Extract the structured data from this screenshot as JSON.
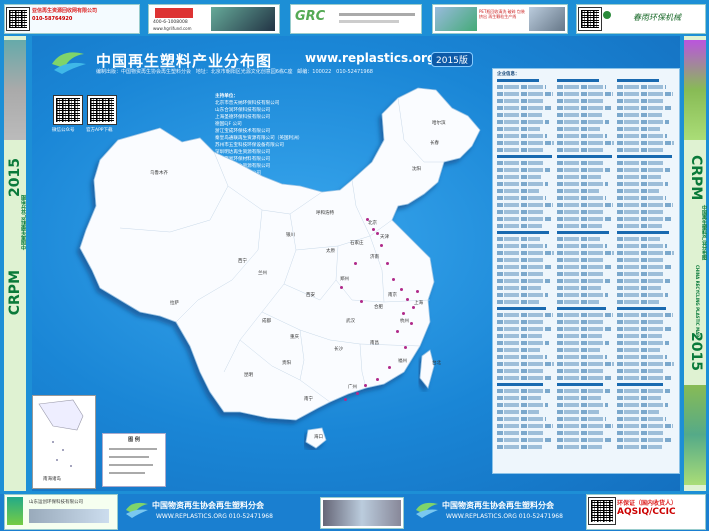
{
  "header": {
    "title": "中国再生塑料产业分布图",
    "url": "www.replastics.org",
    "edition": "2015版",
    "subline_editor": "编制出版：中国物资再生协会再生塑料分会",
    "subline_address": "地址：北京市朝阳区光源文化创意园6栋C座",
    "subline_post": "邮编：100022",
    "subline_phone": "010-52471968"
  },
  "side": {
    "brand": "CRPM",
    "cn": "中国再生塑料产业分布图",
    "en": "CHINA RECYCLING PLASTIC MAP",
    "year": "2015"
  },
  "qr": {
    "left_caption": "微信公众号",
    "right_caption": "官方APP下载"
  },
  "sponsors": {
    "heading": "主持单位：",
    "items": [
      "北京市普天纳环保科技有限公司",
      "山东合润环保科技有限公司",
      "上海圣德环保科技有限公司",
      "德国EJF 公司",
      "浙江宝成环保技术有限公司",
      "秦皇岛通联再生资源有限公司（英国利洲）",
      "苏州市五宝科技环保设备有限公司",
      "深圳明达再生资源有限公司",
      "安徽原易环保材料有限公司",
      "江苏新顺再生资源有限公司",
      "苏州华塑环保有限公司"
    ]
  },
  "map": {
    "cities": [
      {
        "name": "乌鲁木齐"
      },
      {
        "name": "拉萨"
      },
      {
        "name": "西宁"
      },
      {
        "name": "兰州"
      },
      {
        "name": "银川"
      },
      {
        "name": "呼和浩特"
      },
      {
        "name": "北京"
      },
      {
        "name": "天津"
      },
      {
        "name": "石家庄"
      },
      {
        "name": "太原"
      },
      {
        "name": "济南"
      },
      {
        "name": "郑州"
      },
      {
        "name": "西安"
      },
      {
        "name": "成都"
      },
      {
        "name": "重庆"
      },
      {
        "name": "武汉"
      },
      {
        "name": "长沙"
      },
      {
        "name": "南京"
      },
      {
        "name": "上海"
      },
      {
        "name": "杭州"
      },
      {
        "name": "合肥"
      },
      {
        "name": "南昌"
      },
      {
        "name": "福州"
      },
      {
        "name": "广州"
      },
      {
        "name": "南宁"
      },
      {
        "name": "海口"
      },
      {
        "name": "昆明"
      },
      {
        "name": "贵阳"
      },
      {
        "name": "哈尔滨"
      },
      {
        "name": "长春"
      },
      {
        "name": "沈阳"
      },
      {
        "name": "台北"
      }
    ],
    "inset_label": "南海诸岛",
    "legend_title": "图 例"
  },
  "list": {
    "heading": "企业信息："
  },
  "footer": {
    "org1": "中国物资再生协会再生塑料分会",
    "url1": "WWW.REPLASTICS.ORG  010-52471968",
    "org2": "中国物资再生协会再生塑料分会",
    "url2": "WWW.REPLASTICS.ORG  010-52471968",
    "aqsiq": "AQSIQ/CCIC",
    "aqsiq_cn": "环保证（国内收货人）",
    "left_company": "山东运创环保科技有限公司"
  },
  "ads": {
    "top1_title": "亚信再生资源回收网有限公司",
    "top1_phone": "010-58764920",
    "top2_phone": "400-6-1008008",
    "top2_url": "www.hgrlifund.com",
    "top3_tag": "GRC",
    "top4_text": "PET瓶回收清洗 破碎 包装 挤出 再生颗粒生产线",
    "top5_text": "春雨环保机械"
  },
  "colors": {
    "ocean": "#1a86d6",
    "land": "#ffffff",
    "accent": "#0a7a3a",
    "dots": "#b02a8a"
  }
}
